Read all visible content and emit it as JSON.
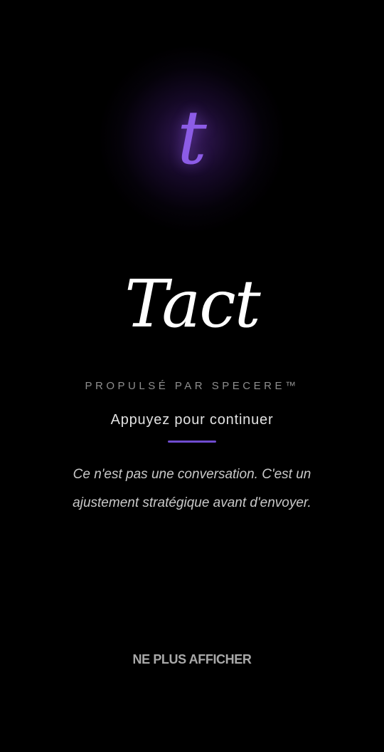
{
  "splash": {
    "logo_letter": "t",
    "wordmark": "Tact",
    "powered_by": "PROPULSÉ PAR SPECERE™",
    "tap_to_continue": "Appuyez pour continuer",
    "tagline_line1": "Ce n'est pas une conversation. C'est un",
    "tagline_line2": "ajustement stratégique avant d'envoyer.",
    "dont_show_again": "NE PLUS AFFICHER"
  },
  "colors": {
    "background": "#000000",
    "accent": "#8c5ce6",
    "divider": "#6f4ccf",
    "primary_text": "#ffffff",
    "secondary_text": "#8e8e8e"
  }
}
